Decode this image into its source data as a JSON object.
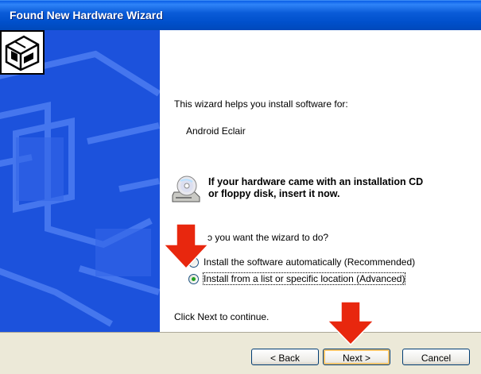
{
  "window": {
    "title": "Found New Hardware Wizard"
  },
  "content": {
    "intro": "This wizard helps you install software for:",
    "device": "Android Eclair",
    "cd_line1": "If your hardware came with an installation CD",
    "cd_line2": "or floppy disk, insert it now.",
    "question": "ɔ you want the wizard to do?",
    "options": [
      {
        "label": "Install the software automatically (Recommended)",
        "selected": false
      },
      {
        "label": "Install from a list or specific location (Advanced)",
        "selected": true
      }
    ],
    "continue": "Click Next to continue."
  },
  "buttons": {
    "back": "< Back",
    "next": "Next >",
    "cancel": "Cancel"
  },
  "colors": {
    "title_bar": "#0a5bd8",
    "sidebar": "#1a4fd8",
    "arrow": "#e8270e",
    "radio_dot": "#21a121"
  },
  "icons": [
    "hardware-box-icon",
    "cd-drive-icon",
    "red-arrow-annotation"
  ]
}
